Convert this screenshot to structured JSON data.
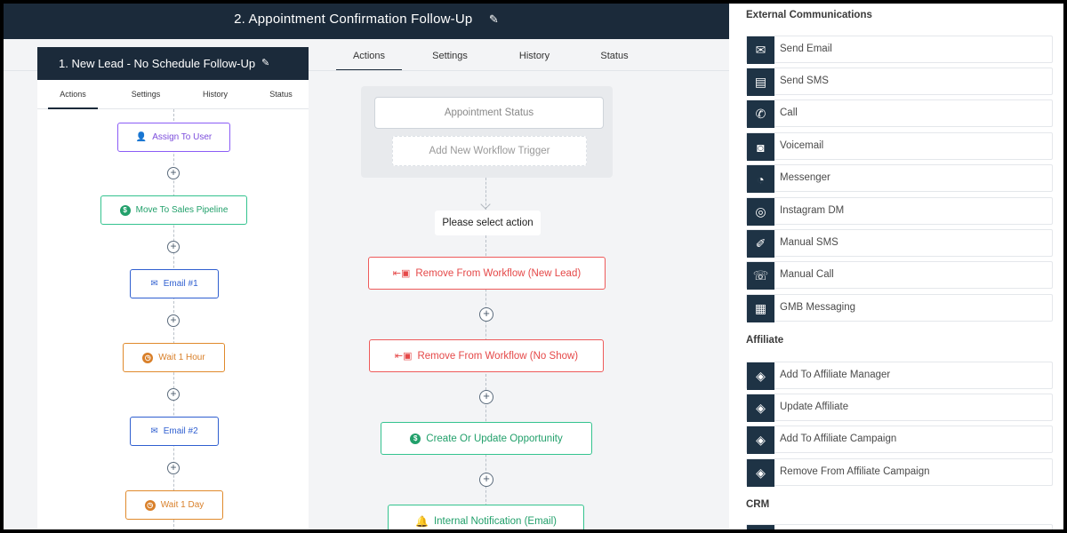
{
  "main": {
    "title": "2. Appointment Confirmation Follow-Up",
    "tabs": [
      "Actions",
      "Settings",
      "History",
      "Status"
    ],
    "trigger_status": "Appointment Status",
    "add_trigger": "Add New Workflow Trigger",
    "select_action": "Please select action",
    "nodes": [
      "Remove From Workflow (New Lead)",
      "Remove From Workflow (No Show)",
      "Create Or Update Opportunity",
      "Internal Notification (Email)"
    ]
  },
  "left_workflow": {
    "title": "1. New Lead - No Schedule Follow-Up",
    "tabs": [
      "Actions",
      "Settings",
      "History",
      "Status"
    ],
    "nodes": [
      "Assign To User",
      "Move To Sales Pipeline",
      "Email #1",
      "Wait 1 Hour",
      "Email #2",
      "Wait 1 Day"
    ]
  },
  "sidebar": {
    "sections": [
      {
        "title": "External Communications",
        "items": [
          {
            "label": "Send Email",
            "icon": "envelope-icon"
          },
          {
            "label": "Send SMS",
            "icon": "chat-bubble-icon"
          },
          {
            "label": "Call",
            "icon": "phone-icon"
          },
          {
            "label": "Voicemail",
            "icon": "voicemail-icon"
          },
          {
            "label": "Messenger",
            "icon": "messenger-icon"
          },
          {
            "label": "Instagram DM",
            "icon": "instagram-icon"
          },
          {
            "label": "Manual SMS",
            "icon": "manual-sms-icon"
          },
          {
            "label": "Manual Call",
            "icon": "manual-call-icon"
          },
          {
            "label": "GMB Messaging",
            "icon": "gmb-store-icon"
          }
        ]
      },
      {
        "title": "Affiliate",
        "items": [
          {
            "label": "Add To Affiliate Manager",
            "icon": "handshake-icon"
          },
          {
            "label": "Update Affiliate",
            "icon": "handshake-icon"
          },
          {
            "label": "Add To Affiliate Campaign",
            "icon": "handshake-icon"
          },
          {
            "label": "Remove From Affiliate Campaign",
            "icon": "handshake-icon"
          }
        ]
      },
      {
        "title": "CRM",
        "items": []
      }
    ]
  },
  "colors": {
    "header": "#1b2a3a",
    "purple": "#8b5cf6",
    "green": "#34c38f",
    "blue": "#2f5fd0",
    "orange": "#e08a2c",
    "red": "#ee5a5a"
  }
}
